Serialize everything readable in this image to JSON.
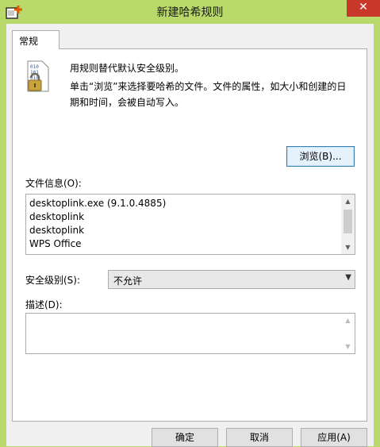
{
  "window": {
    "title": "新建哈希规则",
    "close_glyph": "✕"
  },
  "tabs": [
    {
      "label": "常规"
    }
  ],
  "general": {
    "description_line1": "用规则替代默认安全级别。",
    "description_line2": "单击“浏览”来选择要哈希的文件。文件的属性，如大小和创建的日期和时间，会被自动写入。",
    "browse_label": "浏览(B)...",
    "file_info_label": "文件信息(O):",
    "file_info_rows": [
      "desktoplink.exe (9.1.0.4885)",
      "desktoplink",
      "desktoplink",
      "WPS Office"
    ],
    "security_level_label": "安全级别(S):",
    "security_level_value": "不允许",
    "description_label": "描述(D):",
    "description_value": ""
  },
  "buttons": {
    "ok": "确定",
    "cancel": "取消",
    "apply": "应用(A)"
  },
  "colors": {
    "titlebar": "#b9d96b",
    "close": "#c7382b",
    "focused_button_border": "#3c7fb1"
  },
  "icons": {
    "app": "policy-add-icon",
    "lock": "binary-lock-icon"
  }
}
